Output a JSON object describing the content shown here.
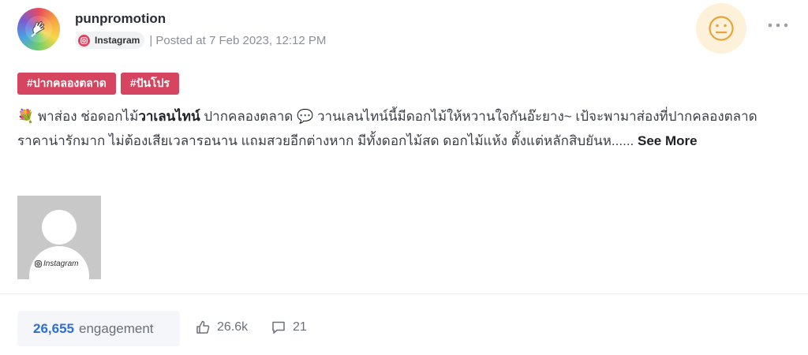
{
  "post": {
    "username": "punpromotion",
    "platform": "Instagram",
    "posted_at": "| Posted at 7 Feb 2023, 12:12 PM",
    "sentiment_icon": "neutral-face-icon",
    "menu_icon": "more-horizontal-icon"
  },
  "tags": [
    "#ปากคลองตลาด",
    "#ปันโปร"
  ],
  "caption": {
    "emoji_flower": "💐",
    "part1": " พาส่อง ช่อดอกไม้",
    "bold": "วาเลนไทน์",
    "part2": " ปากคลองตลาด ",
    "emoji_speech": "💬",
    "part3": " วานเลนไทน์นี้มีดอกไม้ให้หวานใจกันอ๊ะยาง~ เป้จะพามาส่องที่ปากคลองตลาด ราคาน่ารักมาก ไม่ต้องเสียเวลารอนาน แถมสวยอีกต่างหาก มีทั้งดอกไม้สด ดอกไม้แห้ง ตั้งแต่หลักสิบยันห...... ",
    "see_more": "See More"
  },
  "media": {
    "label": "Instagram"
  },
  "stats": {
    "engagement_value": "26,655",
    "engagement_label": "engagement",
    "likes": "26.6k",
    "comments": "21"
  },
  "colors": {
    "tag_bg": "#d64560",
    "engagement_accent": "#2e6fd6",
    "sentiment_bg": "#fdf1d9",
    "sentiment_face": "#e8a33d"
  }
}
